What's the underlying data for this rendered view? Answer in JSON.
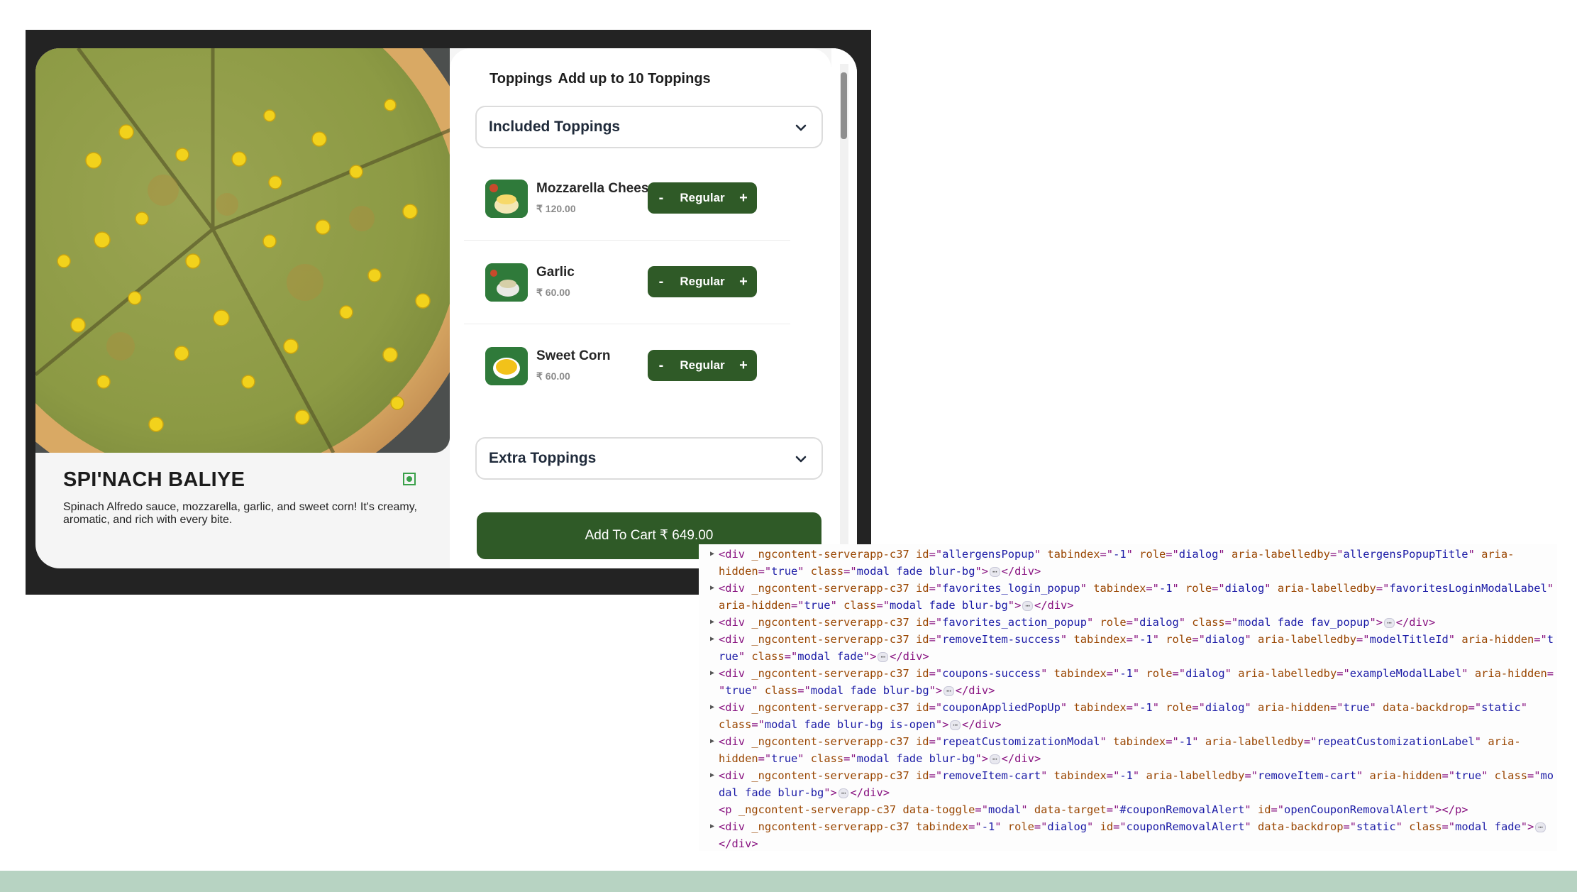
{
  "product": {
    "name": "SPI'NACH BALIYE",
    "description": "Spinach Alfredo sauce, mozzarella, garlic, and sweet corn! It's creamy, aromatic, and rich with every bite."
  },
  "toppings": {
    "title": "Toppings",
    "subtitle": "Add up to 10 Toppings",
    "included_label": "Included Toppings",
    "extra_label": "Extra Toppings",
    "items": [
      {
        "name": "Mozzarella Cheese",
        "price": "₹ 120.00",
        "size": "Regular"
      },
      {
        "name": "Garlic",
        "price": "₹ 60.00",
        "size": "Regular"
      },
      {
        "name": "Sweet Corn",
        "price": "₹ 60.00",
        "size": "Regular"
      }
    ],
    "minus": "-",
    "plus": "+"
  },
  "cart": {
    "label": "Add To Cart ₹ 649.00"
  },
  "colors": {
    "accent_green": "#2f5a27",
    "veg_green": "#3aa14a",
    "band": "#b7d3c2"
  },
  "devtools": {
    "lines": [
      {
        "l1": [
          [
            "t",
            "<div "
          ],
          [
            "n",
            "_ngcontent-serverapp-c37"
          ],
          [
            "t",
            " "
          ],
          [
            "n",
            "id"
          ],
          [
            "t",
            "=\""
          ],
          [
            "v",
            "allergensPopup"
          ],
          [
            "t",
            "\" "
          ],
          [
            "n",
            "tabindex"
          ],
          [
            "t",
            "=\""
          ],
          [
            "v",
            "-1"
          ],
          [
            "t",
            "\" "
          ],
          [
            "n",
            "role"
          ],
          [
            "t",
            "=\""
          ],
          [
            "v",
            "dialog"
          ],
          [
            "t",
            "\" "
          ],
          [
            "n",
            "aria-labelledby"
          ],
          [
            "t",
            "=\""
          ],
          [
            "v",
            "allergensPopupTitle"
          ],
          [
            "t",
            "\" "
          ],
          [
            "n",
            "aria-"
          ]
        ],
        "l2": [
          [
            "n",
            "hidden"
          ],
          [
            "t",
            "=\""
          ],
          [
            "v",
            "true"
          ],
          [
            "t",
            "\" "
          ],
          [
            "n",
            "class"
          ],
          [
            "t",
            "=\""
          ],
          [
            "v",
            "modal fade blur-bg"
          ],
          [
            "t",
            "\">"
          ],
          [
            "e",
            "⋯"
          ],
          [
            "t",
            "</div>"
          ]
        ]
      },
      {
        "l1": [
          [
            "t",
            "<div "
          ],
          [
            "n",
            "_ngcontent-serverapp-c37"
          ],
          [
            "t",
            " "
          ],
          [
            "n",
            "id"
          ],
          [
            "t",
            "=\""
          ],
          [
            "v",
            "favorites_login_popup"
          ],
          [
            "t",
            "\" "
          ],
          [
            "n",
            "tabindex"
          ],
          [
            "t",
            "=\""
          ],
          [
            "v",
            "-1"
          ],
          [
            "t",
            "\" "
          ],
          [
            "n",
            "role"
          ],
          [
            "t",
            "=\""
          ],
          [
            "v",
            "dialog"
          ],
          [
            "t",
            "\" "
          ],
          [
            "n",
            "aria-labelledby"
          ],
          [
            "t",
            "=\""
          ],
          [
            "v",
            "favoritesLoginModalLabel"
          ],
          [
            "t",
            "\""
          ]
        ],
        "l2": [
          [
            "n",
            "aria-hidden"
          ],
          [
            "t",
            "=\""
          ],
          [
            "v",
            "true"
          ],
          [
            "t",
            "\" "
          ],
          [
            "n",
            "class"
          ],
          [
            "t",
            "=\""
          ],
          [
            "v",
            "modal fade blur-bg"
          ],
          [
            "t",
            "\">"
          ],
          [
            "e",
            "⋯"
          ],
          [
            "t",
            "</div>"
          ]
        ]
      },
      {
        "l1": [
          [
            "t",
            "<div "
          ],
          [
            "n",
            "_ngcontent-serverapp-c37"
          ],
          [
            "t",
            " "
          ],
          [
            "n",
            "id"
          ],
          [
            "t",
            "=\""
          ],
          [
            "v",
            "favorites_action_popup"
          ],
          [
            "t",
            "\" "
          ],
          [
            "n",
            "role"
          ],
          [
            "t",
            "=\""
          ],
          [
            "v",
            "dialog"
          ],
          [
            "t",
            "\" "
          ],
          [
            "n",
            "class"
          ],
          [
            "t",
            "=\""
          ],
          [
            "v",
            "modal fade fav_popup"
          ],
          [
            "t",
            "\">"
          ],
          [
            "e",
            "⋯"
          ],
          [
            "t",
            "</div>"
          ]
        ]
      },
      {
        "l1": [
          [
            "t",
            "<div "
          ],
          [
            "n",
            "_ngcontent-serverapp-c37"
          ],
          [
            "t",
            " "
          ],
          [
            "n",
            "id"
          ],
          [
            "t",
            "=\""
          ],
          [
            "v",
            "removeItem-success"
          ],
          [
            "t",
            "\" "
          ],
          [
            "n",
            "tabindex"
          ],
          [
            "t",
            "=\""
          ],
          [
            "v",
            "-1"
          ],
          [
            "t",
            "\" "
          ],
          [
            "n",
            "role"
          ],
          [
            "t",
            "=\""
          ],
          [
            "v",
            "dialog"
          ],
          [
            "t",
            "\" "
          ],
          [
            "n",
            "aria-labelledby"
          ],
          [
            "t",
            "=\""
          ],
          [
            "v",
            "modelTitleId"
          ],
          [
            "t",
            "\" "
          ],
          [
            "n",
            "aria-hidden"
          ],
          [
            "t",
            "=\""
          ],
          [
            "v",
            "t"
          ]
        ],
        "l2": [
          [
            "v",
            "rue"
          ],
          [
            "t",
            "\" "
          ],
          [
            "n",
            "class"
          ],
          [
            "t",
            "=\""
          ],
          [
            "v",
            "modal fade"
          ],
          [
            "t",
            "\">"
          ],
          [
            "e",
            "⋯"
          ],
          [
            "t",
            "</div>"
          ]
        ]
      },
      {
        "l1": [
          [
            "t",
            "<div "
          ],
          [
            "n",
            "_ngcontent-serverapp-c37"
          ],
          [
            "t",
            " "
          ],
          [
            "n",
            "id"
          ],
          [
            "t",
            "=\""
          ],
          [
            "v",
            "coupons-success"
          ],
          [
            "t",
            "\" "
          ],
          [
            "n",
            "tabindex"
          ],
          [
            "t",
            "=\""
          ],
          [
            "v",
            "-1"
          ],
          [
            "t",
            "\" "
          ],
          [
            "n",
            "role"
          ],
          [
            "t",
            "=\""
          ],
          [
            "v",
            "dialog"
          ],
          [
            "t",
            "\" "
          ],
          [
            "n",
            "aria-labelledby"
          ],
          [
            "t",
            "=\""
          ],
          [
            "v",
            "exampleModalLabel"
          ],
          [
            "t",
            "\" "
          ],
          [
            "n",
            "aria-hidden"
          ],
          [
            "t",
            "="
          ]
        ],
        "l2": [
          [
            "t",
            "\""
          ],
          [
            "v",
            "true"
          ],
          [
            "t",
            "\" "
          ],
          [
            "n",
            "class"
          ],
          [
            "t",
            "=\""
          ],
          [
            "v",
            "modal fade blur-bg"
          ],
          [
            "t",
            "\">"
          ],
          [
            "e",
            "⋯"
          ],
          [
            "t",
            "</div>"
          ]
        ]
      },
      {
        "l1": [
          [
            "t",
            "<div "
          ],
          [
            "n",
            "_ngcontent-serverapp-c37"
          ],
          [
            "t",
            " "
          ],
          [
            "n",
            "id"
          ],
          [
            "t",
            "=\""
          ],
          [
            "v",
            "couponAppliedPopUp"
          ],
          [
            "t",
            "\" "
          ],
          [
            "n",
            "tabindex"
          ],
          [
            "t",
            "=\""
          ],
          [
            "v",
            "-1"
          ],
          [
            "t",
            "\" "
          ],
          [
            "n",
            "role"
          ],
          [
            "t",
            "=\""
          ],
          [
            "v",
            "dialog"
          ],
          [
            "t",
            "\" "
          ],
          [
            "n",
            "aria-hidden"
          ],
          [
            "t",
            "=\""
          ],
          [
            "v",
            "true"
          ],
          [
            "t",
            "\" "
          ],
          [
            "n",
            "data-backdrop"
          ],
          [
            "t",
            "=\""
          ],
          [
            "v",
            "static"
          ],
          [
            "t",
            "\""
          ]
        ],
        "l2": [
          [
            "n",
            "class"
          ],
          [
            "t",
            "=\""
          ],
          [
            "v",
            "modal fade blur-bg is-open"
          ],
          [
            "t",
            "\">"
          ],
          [
            "e",
            "⋯"
          ],
          [
            "t",
            "</div>"
          ]
        ]
      },
      {
        "l1": [
          [
            "t",
            "<div "
          ],
          [
            "n",
            "_ngcontent-serverapp-c37"
          ],
          [
            "t",
            " "
          ],
          [
            "n",
            "id"
          ],
          [
            "t",
            "=\""
          ],
          [
            "v",
            "repeatCustomizationModal"
          ],
          [
            "t",
            "\" "
          ],
          [
            "n",
            "tabindex"
          ],
          [
            "t",
            "=\""
          ],
          [
            "v",
            "-1"
          ],
          [
            "t",
            "\" "
          ],
          [
            "n",
            "aria-labelledby"
          ],
          [
            "t",
            "=\""
          ],
          [
            "v",
            "repeatCustomizationLabel"
          ],
          [
            "t",
            "\" "
          ],
          [
            "n",
            "aria-"
          ]
        ],
        "l2": [
          [
            "n",
            "hidden"
          ],
          [
            "t",
            "=\""
          ],
          [
            "v",
            "true"
          ],
          [
            "t",
            "\" "
          ],
          [
            "n",
            "class"
          ],
          [
            "t",
            "=\""
          ],
          [
            "v",
            "modal fade blur-bg"
          ],
          [
            "t",
            "\">"
          ],
          [
            "e",
            "⋯"
          ],
          [
            "t",
            "</div>"
          ]
        ]
      },
      {
        "l1": [
          [
            "t",
            "<div "
          ],
          [
            "n",
            "_ngcontent-serverapp-c37"
          ],
          [
            "t",
            " "
          ],
          [
            "n",
            "id"
          ],
          [
            "t",
            "=\""
          ],
          [
            "v",
            "removeItem-cart"
          ],
          [
            "t",
            "\" "
          ],
          [
            "n",
            "tabindex"
          ],
          [
            "t",
            "=\""
          ],
          [
            "v",
            "-1"
          ],
          [
            "t",
            "\" "
          ],
          [
            "n",
            "aria-labelledby"
          ],
          [
            "t",
            "=\""
          ],
          [
            "v",
            "removeItem-cart"
          ],
          [
            "t",
            "\" "
          ],
          [
            "n",
            "aria-hidden"
          ],
          [
            "t",
            "=\""
          ],
          [
            "v",
            "true"
          ],
          [
            "t",
            "\" "
          ],
          [
            "n",
            "class"
          ],
          [
            "t",
            "=\""
          ],
          [
            "v",
            "mo"
          ]
        ],
        "l2": [
          [
            "v",
            "dal fade blur-bg"
          ],
          [
            "t",
            "\">"
          ],
          [
            "e",
            "⋯"
          ],
          [
            "t",
            "</div>"
          ]
        ]
      },
      {
        "noarrow": true,
        "l1": [
          [
            "t",
            "<p "
          ],
          [
            "n",
            "_ngcontent-serverapp-c37"
          ],
          [
            "t",
            " "
          ],
          [
            "n",
            "data-toggle"
          ],
          [
            "t",
            "=\""
          ],
          [
            "v",
            "modal"
          ],
          [
            "t",
            "\" "
          ],
          [
            "n",
            "data-target"
          ],
          [
            "t",
            "=\""
          ],
          [
            "v",
            "#couponRemovalAlert"
          ],
          [
            "t",
            "\" "
          ],
          [
            "n",
            "id"
          ],
          [
            "t",
            "=\""
          ],
          [
            "v",
            "openCouponRemovalAlert"
          ],
          [
            "t",
            "\"></p>"
          ]
        ]
      },
      {
        "l1": [
          [
            "t",
            "<div "
          ],
          [
            "n",
            "_ngcontent-serverapp-c37"
          ],
          [
            "t",
            " "
          ],
          [
            "n",
            "tabindex"
          ],
          [
            "t",
            "=\""
          ],
          [
            "v",
            "-1"
          ],
          [
            "t",
            "\" "
          ],
          [
            "n",
            "role"
          ],
          [
            "t",
            "=\""
          ],
          [
            "v",
            "dialog"
          ],
          [
            "t",
            "\" "
          ],
          [
            "n",
            "id"
          ],
          [
            "t",
            "=\""
          ],
          [
            "v",
            "couponRemovalAlert"
          ],
          [
            "t",
            "\" "
          ],
          [
            "n",
            "data-backdrop"
          ],
          [
            "t",
            "=\""
          ],
          [
            "v",
            "static"
          ],
          [
            "t",
            "\" "
          ],
          [
            "n",
            "class"
          ],
          [
            "t",
            "=\""
          ],
          [
            "v",
            "modal fade"
          ],
          [
            "t",
            "\">"
          ],
          [
            "e",
            "⋯"
          ]
        ],
        "l2": [
          [
            "t",
            "</div>"
          ]
        ]
      }
    ]
  }
}
